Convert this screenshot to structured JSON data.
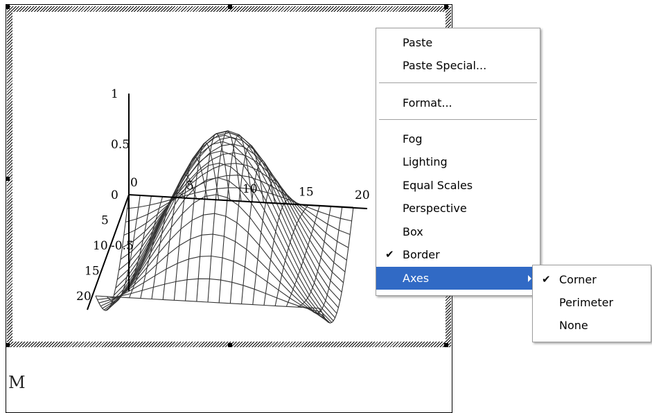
{
  "plot": {
    "z_ticks": [
      "1",
      "0.5",
      "0",
      "-0.5"
    ],
    "x_ticks": [
      "0",
      "5",
      "10",
      "15",
      "20"
    ],
    "y_ticks": [
      "5",
      "10",
      "15",
      "20"
    ],
    "region_label": "M",
    "mesh_size": 20
  },
  "context_menu": {
    "items": [
      {
        "label": "Paste",
        "checked": false
      },
      {
        "label": "Paste Special..."
      },
      {
        "label": "Format..."
      },
      {
        "label": "Fog"
      },
      {
        "label": "Lighting"
      },
      {
        "label": "Equal Scales"
      },
      {
        "label": "Perspective"
      },
      {
        "label": "Box"
      },
      {
        "label": "Border",
        "checked": true
      },
      {
        "label": "Axes",
        "highlighted": true,
        "submenu": true
      }
    ]
  },
  "axes_submenu": {
    "items": [
      {
        "label": "Corner",
        "checked": true
      },
      {
        "label": "Perimeter"
      },
      {
        "label": "None"
      }
    ]
  },
  "colors": {
    "highlight": "#316ac5",
    "mesh": "#333333"
  },
  "icons": {
    "check": "checkmark-icon",
    "arrow": "submenu-arrow-icon"
  }
}
